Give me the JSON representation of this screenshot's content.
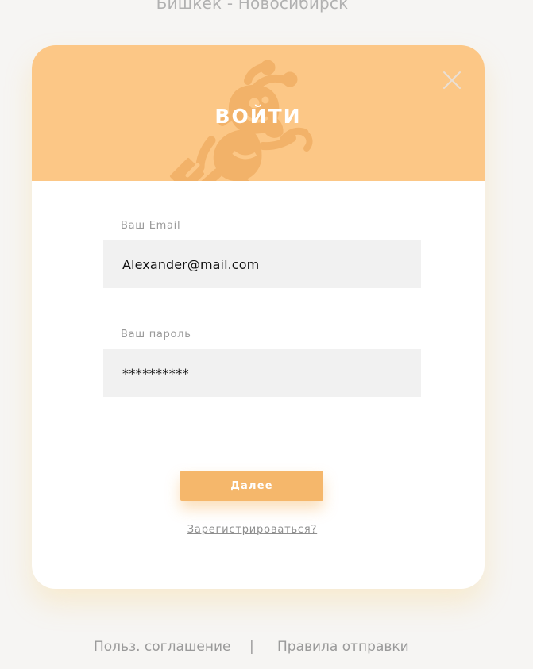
{
  "route": "Бишкек - Новосибирск",
  "modal": {
    "title": "ВОЙТИ",
    "close_icon": "close-icon",
    "mascot_icon": "ant-mascot-icon",
    "email": {
      "label": "Ваш Email",
      "value": "Alexander@mail.com"
    },
    "password": {
      "label": "Ваш пароль",
      "value": "**********"
    },
    "submit_label": "Далее",
    "register_link": "Зарегистрироваться?"
  },
  "footer": {
    "agreement": "Польз. соглашение",
    "separator": "|",
    "rules": "Правила отправки"
  },
  "colors": {
    "header": "#fcc786",
    "button": "#f5b76b",
    "background": "#f6f5f3",
    "input": "#f1f1f1"
  }
}
